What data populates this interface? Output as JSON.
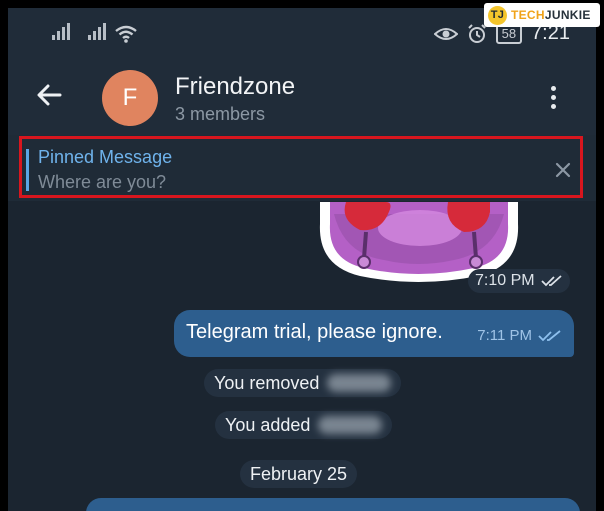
{
  "status_bar": {
    "battery": "58",
    "time": "7:21"
  },
  "watermark": {
    "badge": "TJ",
    "tech": "TECH",
    "junkie": "JUNKIE"
  },
  "header": {
    "avatar_letter": "F",
    "title": "Friendzone",
    "subtitle": "3 members"
  },
  "pinned": {
    "title": "Pinned Message",
    "text": "Where are you?"
  },
  "messages": {
    "sticker_time": "7:10 PM",
    "text": "Telegram trial, please ignore.",
    "text_time": "7:11 PM",
    "service_removed": "You removed",
    "service_added": "You added",
    "date_divider": "February 25"
  },
  "colors": {
    "accent": "#6fb3ec",
    "outgoing_bubble": "#2d5e8e",
    "highlight_frame": "#d8161e",
    "background": "#1b2530"
  }
}
